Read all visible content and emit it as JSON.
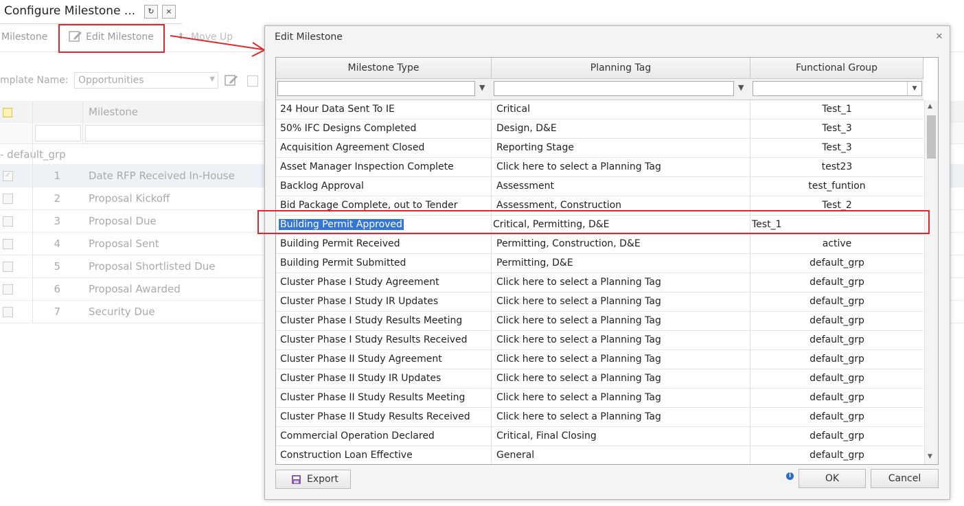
{
  "tab": {
    "title": "Configure Milestone ...",
    "refresh_glyph": "↻",
    "close_glyph": "×"
  },
  "toolbar": {
    "milestone_label": "Milestone",
    "edit_milestone_label": "Edit Milestone",
    "move_up_label": "Move Up"
  },
  "template": {
    "label": "mplate Name:",
    "value": "Opportunities"
  },
  "background_grid": {
    "header_milestone": "Milestone",
    "group_label": "- default_grp",
    "rows": [
      {
        "num": "1",
        "name": "Date RFP Received In-House",
        "checked": true
      },
      {
        "num": "2",
        "name": "Proposal Kickoff",
        "checked": false
      },
      {
        "num": "3",
        "name": "Proposal Due",
        "checked": false
      },
      {
        "num": "4",
        "name": "Proposal Sent",
        "checked": false
      },
      {
        "num": "5",
        "name": "Proposal Shortlisted Due",
        "checked": false
      },
      {
        "num": "6",
        "name": "Proposal Awarded",
        "checked": false
      },
      {
        "num": "7",
        "name": "Security Due",
        "checked": false
      }
    ]
  },
  "dialog": {
    "title": "Edit Milestone",
    "columns": [
      "Milestone Type",
      "Planning Tag",
      "Functional Group"
    ],
    "rows": [
      {
        "type": "24 Hour Data Sent To IE",
        "tag": "Critical",
        "group": "Test_1"
      },
      {
        "type": "50% IFC Designs Completed",
        "tag": "Design, D&E",
        "group": "Test_3"
      },
      {
        "type": "Acquisition Agreement Closed",
        "tag": "Reporting Stage",
        "group": "Test_3"
      },
      {
        "type": "Asset Manager Inspection Complete",
        "tag": "Click here to select a Planning Tag",
        "group": "test23"
      },
      {
        "type": "Backlog Approval",
        "tag": "Assessment",
        "group": "test_funtion"
      },
      {
        "type": "Bid Package Complete, out to Tender",
        "tag": "Assessment, Construction",
        "group": "Test_2"
      },
      {
        "type": "Building Permit Approved",
        "tag": "Critical, Permitting, D&E",
        "group": "Test_1",
        "editing": true
      },
      {
        "type": "Building Permit Received",
        "tag": "Permitting, Construction, D&E",
        "group": "active"
      },
      {
        "type": "Building Permit Submitted",
        "tag": "Permitting, D&E",
        "group": "default_grp"
      },
      {
        "type": "Cluster Phase I Study Agreement",
        "tag": "Click here to select a Planning Tag",
        "group": "default_grp"
      },
      {
        "type": "Cluster Phase I Study IR Updates",
        "tag": "Click here to select a Planning Tag",
        "group": "default_grp"
      },
      {
        "type": "Cluster Phase I Study Results Meeting",
        "tag": "Click here to select a Planning Tag",
        "group": "default_grp"
      },
      {
        "type": "Cluster Phase I Study Results Received",
        "tag": "Click here to select a Planning Tag",
        "group": "default_grp"
      },
      {
        "type": "Cluster Phase II Study Agreement",
        "tag": "Click here to select a Planning Tag",
        "group": "default_grp"
      },
      {
        "type": "Cluster Phase II Study IR Updates",
        "tag": "Click here to select a Planning Tag",
        "group": "default_grp"
      },
      {
        "type": "Cluster Phase II Study Results Meeting",
        "tag": "Click here to select a Planning Tag",
        "group": "default_grp"
      },
      {
        "type": "Cluster Phase II Study Results Received",
        "tag": "Click here to select a Planning Tag",
        "group": "default_grp"
      },
      {
        "type": "Commercial Operation Declared",
        "tag": "Critical, Final Closing",
        "group": "default_grp"
      },
      {
        "type": "Construction Loan Effective",
        "tag": "General",
        "group": "default_grp"
      }
    ],
    "export_label": "Export",
    "ok_label": "OK",
    "cancel_label": "Cancel",
    "close_glyph": "✕"
  },
  "colors": {
    "highlight_red": "#e0262d",
    "selection_blue": "#3575d3"
  }
}
